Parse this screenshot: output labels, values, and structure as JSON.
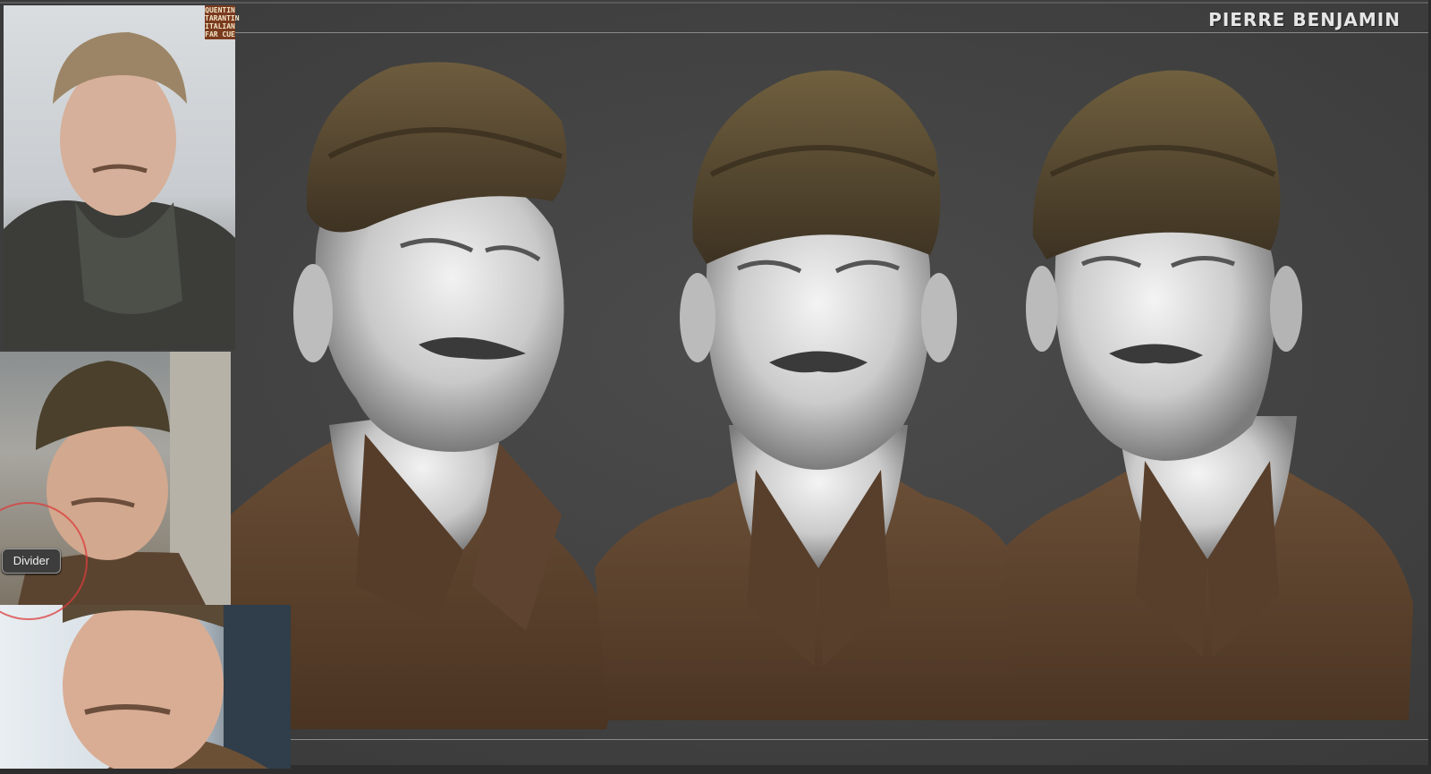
{
  "header": {
    "artist_name": "PIERRE BENJAMIN"
  },
  "reference_panel": {
    "poster_lines": [
      "QUENTIN",
      "TARANTIN",
      "ITALIAN",
      "FAR CUE"
    ]
  },
  "tooltip": {
    "label": "Divider"
  },
  "colors": {
    "background": "#434343",
    "cap": "#5a4a30",
    "skin": "#d9d9d9",
    "shirt": "#5b4330",
    "highlight_ring": "#dc3c3c"
  },
  "icons": [
    "divider-highlight-ring"
  ]
}
